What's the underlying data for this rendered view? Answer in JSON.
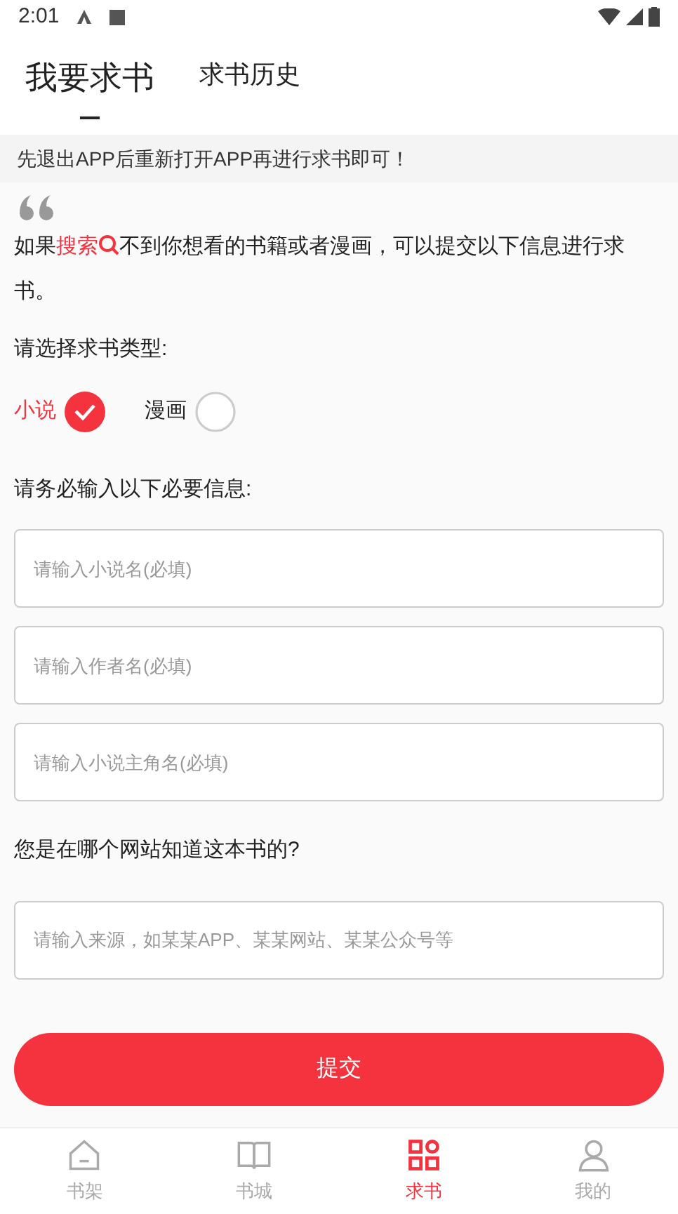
{
  "status_bar": {
    "time": "2:01"
  },
  "tabs": [
    {
      "label": "我要求书",
      "selected": true
    },
    {
      "label": "求书历史",
      "selected": false
    }
  ],
  "notice": "先退出APP后重新打开APP再进行求书即可！",
  "intro": {
    "prefix": "如果",
    "link": "搜索",
    "suffix": "不到你想看的书籍或者漫画，可以提交以下信息进行求书。"
  },
  "type_prompt": "请选择求书类型:",
  "types": [
    {
      "label": "小说",
      "selected": true
    },
    {
      "label": "漫画",
      "selected": false
    }
  ],
  "info_prompt": "请务必输入以下必要信息:",
  "fields": [
    {
      "placeholder": "请输入小说名(必填)"
    },
    {
      "placeholder": "请输入作者名(必填)"
    },
    {
      "placeholder": "请输入小说主角名(必填)"
    }
  ],
  "source_prompt": "您是在哪个网站知道这本书的?",
  "source_field": {
    "placeholder": "请输入来源，如某某APP、某某网站、某某公众号等"
  },
  "submit": "提交",
  "nav": [
    {
      "label": "书架",
      "selected": false
    },
    {
      "label": "书城",
      "selected": false
    },
    {
      "label": "求书",
      "selected": true
    },
    {
      "label": "我的",
      "selected": false
    }
  ]
}
